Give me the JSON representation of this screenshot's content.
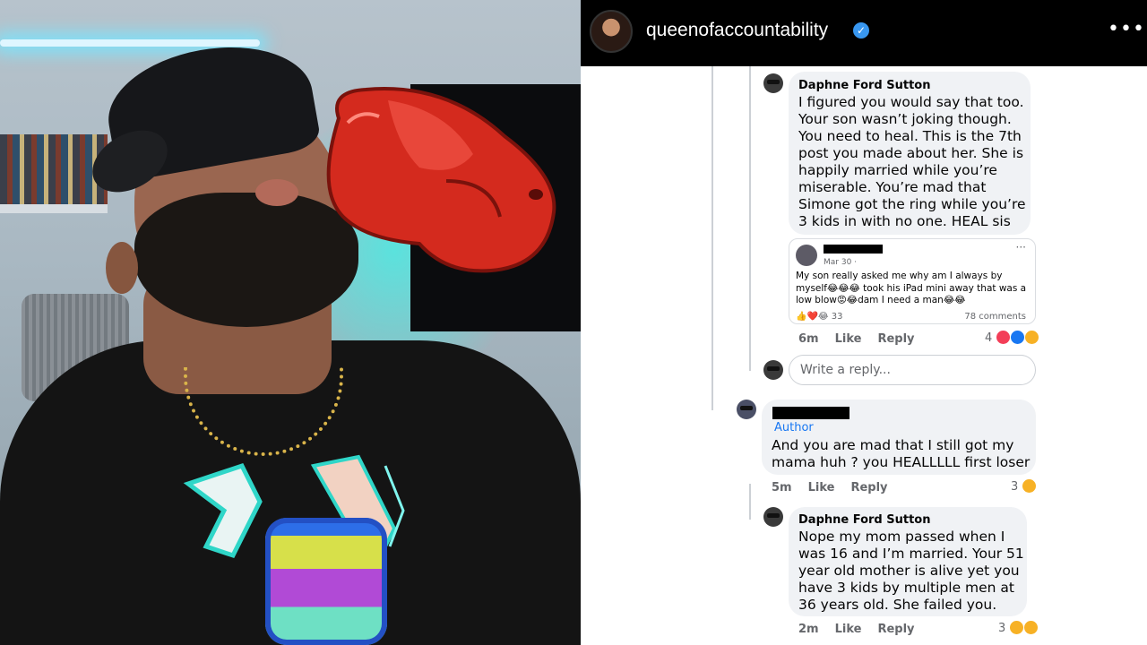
{
  "colors": {
    "verified": "#3897f0",
    "author_label": "#1877f2",
    "glove": "#d42a1e",
    "bubble_bg": "#f0f2f5"
  },
  "header": {
    "username": "queenofaccountability",
    "verified_icon": "verified-badge-icon",
    "more_icon": "•••"
  },
  "comments": [
    {
      "name": "Daphne Ford Sutton",
      "text": "I figured you would say that too.\nYour son wasn’t joking though.\nYou need to heal. This is the 7th\npost you made about her. She is\nhappily married while you’re\nmiserable. You’re mad that\nSimone got the ring while you’re\n3 kids in with no one. HEAL sis",
      "time": "6m",
      "like": "Like",
      "reply": "Reply",
      "reaction_count": "4"
    },
    {
      "author_label": "Author",
      "text": "And you are mad that I still got my\nmama huh ? you HEALLLLL first loser",
      "time": "5m",
      "like": "Like",
      "reply": "Reply",
      "reaction_count": "3"
    },
    {
      "name": "Daphne Ford Sutton",
      "text": "Nope my mom passed when I\nwas 16 and I’m married. Your 51\nyear old mother is alive yet you\nhave 3 kids by multiple men at\n36 years old. She failed you.",
      "time": "2m",
      "like": "Like",
      "reply": "Reply",
      "reaction_count": "3"
    }
  ],
  "shared_post": {
    "date": "Mar 30 ·",
    "more": "···",
    "text": "My son really asked me why am I always by myself😂😂😂 took his iPad mini away that was a low blow😡😂dam I need a man😂😂",
    "reactions": "33",
    "comments": "78 comments"
  },
  "reply_box": {
    "placeholder": "Write a reply..."
  }
}
